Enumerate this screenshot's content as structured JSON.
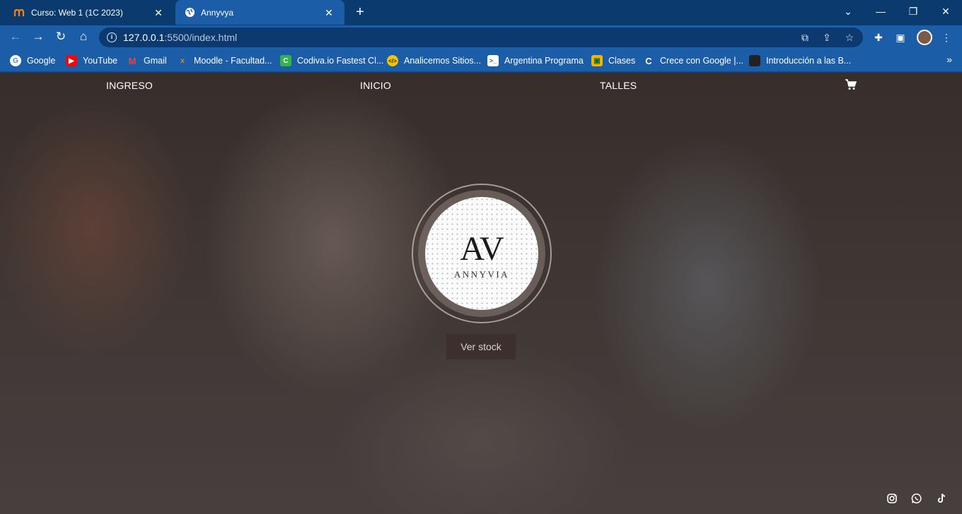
{
  "browser": {
    "tabs": [
      {
        "title": "Curso: Web 1 (1C 2023)",
        "favicon": "moodle-icon",
        "active": false
      },
      {
        "title": "Annyvya",
        "favicon": "globe-icon",
        "active": true
      }
    ],
    "address": {
      "host": "127.0.0.1",
      "path": ":5500/index.html"
    },
    "bookmarks": [
      {
        "label": "Google",
        "icon": "google-icon",
        "color": "#ffffff"
      },
      {
        "label": "YouTube",
        "icon": "youtube-icon",
        "color": "#ff0000"
      },
      {
        "label": "Gmail",
        "icon": "gmail-icon",
        "color": "#ea4335"
      },
      {
        "label": "Moodle - Facultad...",
        "icon": "moodle-icon",
        "color": "#1c5da8"
      },
      {
        "label": "Codiva.io Fastest Cl...",
        "icon": "codiva-icon",
        "color": "#35b34a"
      },
      {
        "label": "Analicemos Sitios...",
        "icon": "code-icon",
        "color": "#f5c400"
      },
      {
        "label": "Argentina Programa",
        "icon": "terminal-icon",
        "color": "#ffffff"
      },
      {
        "label": "Clases",
        "icon": "classroom-icon",
        "color": "#f4b400"
      },
      {
        "label": "Crece con Google |...",
        "icon": "google-c-icon",
        "color": "#ffffff"
      },
      {
        "label": "Introducción a las B...",
        "icon": "bookmark-thumb-icon",
        "color": "#222222"
      }
    ]
  },
  "site": {
    "nav": {
      "ingreso": "INGRESO",
      "inicio": "INICIO",
      "talles": "TALLES"
    },
    "logo": {
      "monogram": "AV",
      "wordmark": "ANNYVIA"
    },
    "stock_button": "Ver stock",
    "social": [
      "instagram-icon",
      "whatsapp-icon",
      "tiktok-icon"
    ]
  },
  "colors": {
    "chrome": "#1c5da8",
    "tabstrip": "#0b3a6e",
    "button": "#3d302c"
  }
}
